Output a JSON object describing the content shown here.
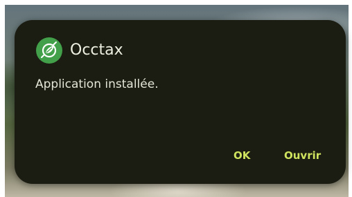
{
  "dialog": {
    "app_name": "Occtax",
    "app_icon": "occtax-leaf-icon",
    "message": "Application installée.",
    "buttons": {
      "ok_label": "OK",
      "open_label": "Ouvrir"
    }
  },
  "colors": {
    "dialog_bg": "#1c1d12",
    "accent": "#cfe35f",
    "icon_green": "#43a04a"
  }
}
